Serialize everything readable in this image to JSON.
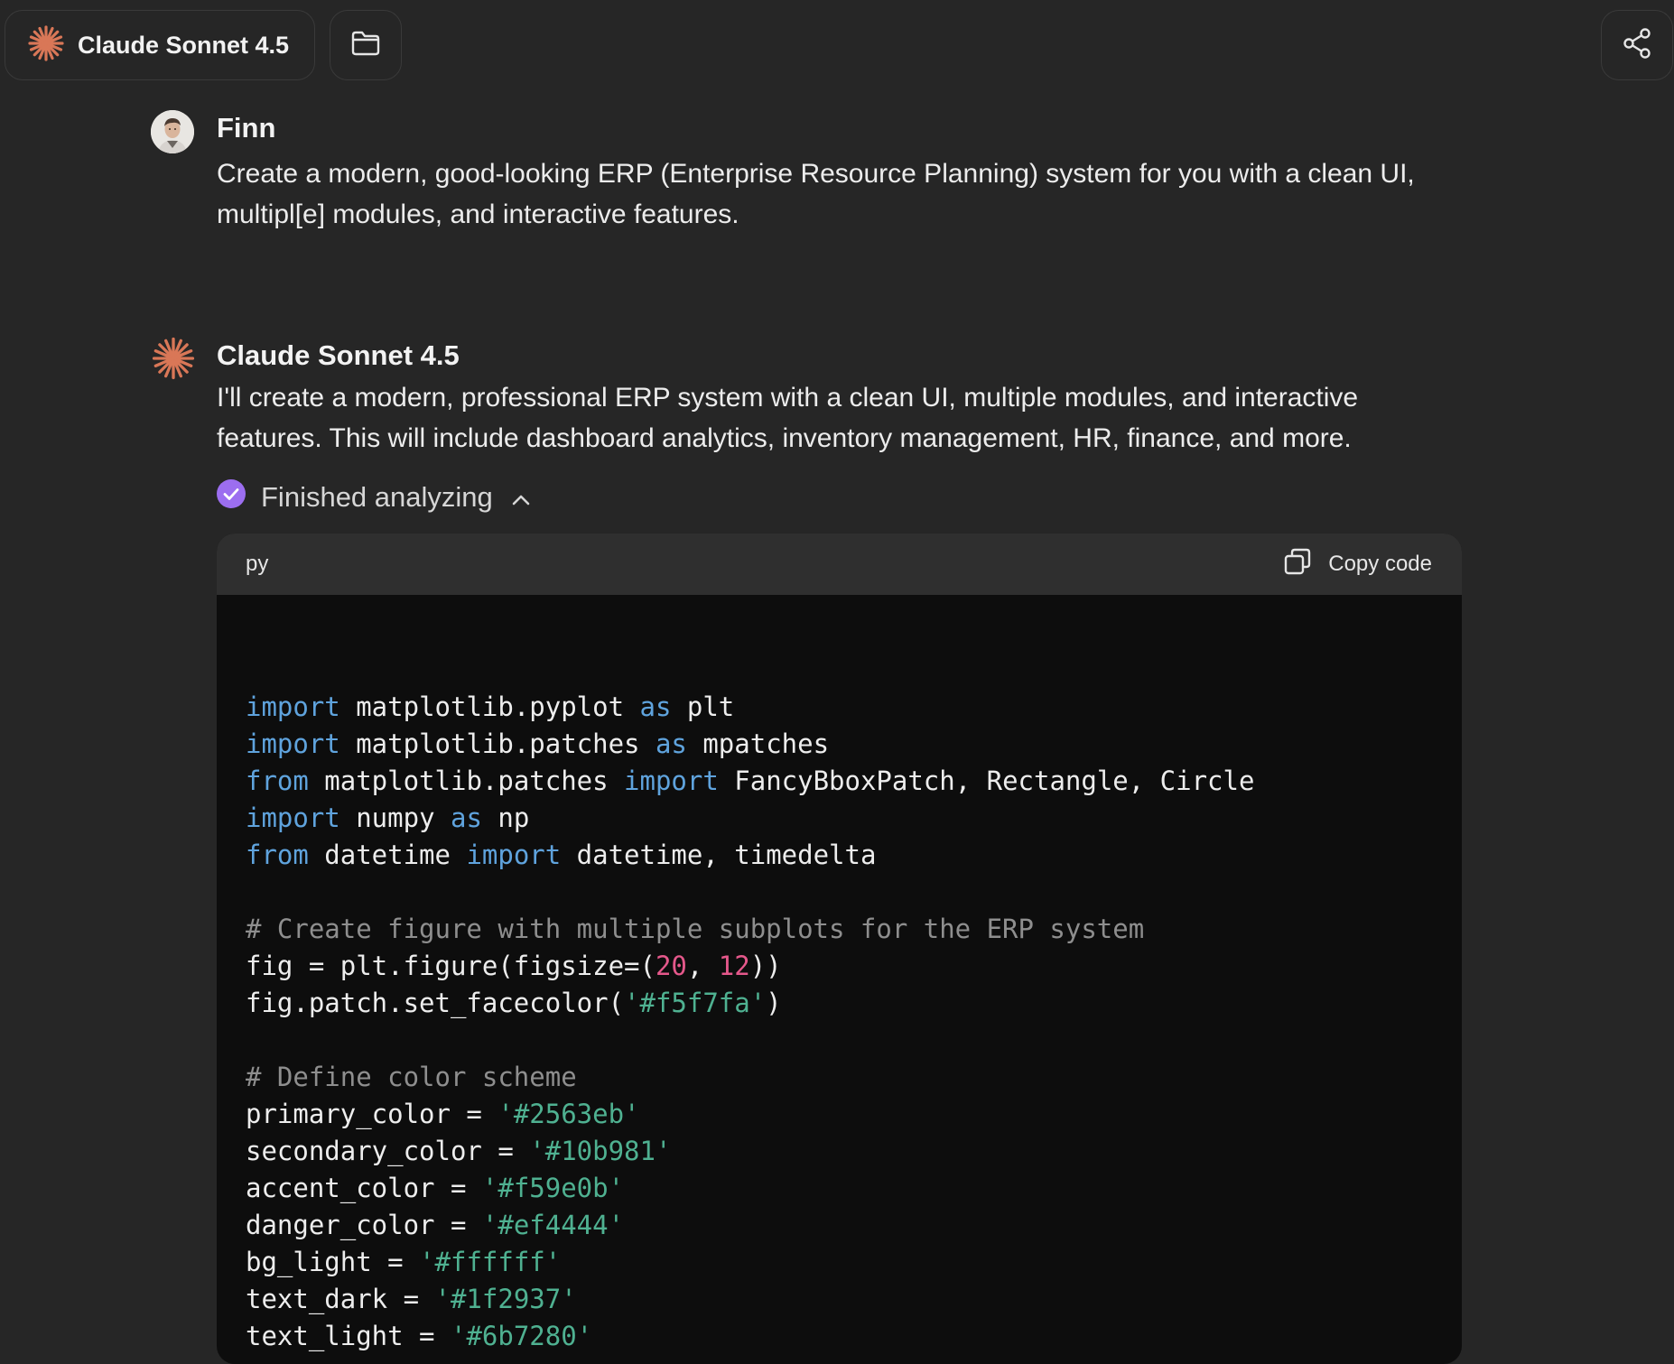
{
  "header": {
    "model_name": "Claude Sonnet 4.5"
  },
  "conversation": {
    "user_message": {
      "sender": "Finn",
      "text": "Create a modern, good-looking ERP (Enterprise Resource Planning) system for you with a clean UI, multipl[e] modules, and interactive features."
    },
    "assistant_message": {
      "sender": "Claude Sonnet 4.5",
      "text": "I'll create a modern, professional ERP system with a clean UI, multiple modules, and interactive features. This will include dashboard analytics, inventory management, HR, finance, and more.",
      "status": "Finished analyzing"
    }
  },
  "code_block": {
    "language": "py",
    "copy_label": "Copy code",
    "lines": [
      [],
      [
        {
          "t": "import",
          "c": "kw"
        },
        {
          "t": " matplotlib.pyplot "
        },
        {
          "t": "as",
          "c": "kw"
        },
        {
          "t": " plt"
        }
      ],
      [
        {
          "t": "import",
          "c": "kw"
        },
        {
          "t": " matplotlib.patches "
        },
        {
          "t": "as",
          "c": "kw"
        },
        {
          "t": " mpatches"
        }
      ],
      [
        {
          "t": "from",
          "c": "kw"
        },
        {
          "t": " matplotlib.patches "
        },
        {
          "t": "import",
          "c": "kw"
        },
        {
          "t": " FancyBboxPatch, Rectangle, Circle"
        }
      ],
      [
        {
          "t": "import",
          "c": "kw"
        },
        {
          "t": " numpy "
        },
        {
          "t": "as",
          "c": "kw"
        },
        {
          "t": " np"
        }
      ],
      [
        {
          "t": "from",
          "c": "kw"
        },
        {
          "t": " datetime "
        },
        {
          "t": "import",
          "c": "kw"
        },
        {
          "t": " datetime, timedelta"
        }
      ],
      [],
      [
        {
          "t": "# Create figure with multiple subplots for the ERP system",
          "c": "cm"
        }
      ],
      [
        {
          "t": "fig = plt.figure(figsize=("
        },
        {
          "t": "20",
          "c": "num"
        },
        {
          "t": ", "
        },
        {
          "t": "12",
          "c": "num"
        },
        {
          "t": "))"
        }
      ],
      [
        {
          "t": "fig.patch.set_facecolor("
        },
        {
          "t": "'#f5f7fa'",
          "c": "str"
        },
        {
          "t": ")"
        }
      ],
      [],
      [
        {
          "t": "# Define color scheme",
          "c": "cm"
        }
      ],
      [
        {
          "t": "primary_color = "
        },
        {
          "t": "'#2563eb'",
          "c": "str"
        }
      ],
      [
        {
          "t": "secondary_color = "
        },
        {
          "t": "'#10b981'",
          "c": "str"
        }
      ],
      [
        {
          "t": "accent_color = "
        },
        {
          "t": "'#f59e0b'",
          "c": "str"
        }
      ],
      [
        {
          "t": "danger_color = "
        },
        {
          "t": "'#ef4444'",
          "c": "str"
        }
      ],
      [
        {
          "t": "bg_light = "
        },
        {
          "t": "'#ffffff'",
          "c": "str"
        }
      ],
      [
        {
          "t": "text_dark = "
        },
        {
          "t": "'#1f2937'",
          "c": "str"
        }
      ],
      [
        {
          "t": "text_light = "
        },
        {
          "t": "'#6b7280'",
          "c": "str"
        }
      ]
    ]
  },
  "colors": {
    "background": "#262626",
    "code_background": "#0d0d0d",
    "code_header": "#2f2f2f",
    "brand_accent": "#d97757",
    "status_check": "#9c6ef0",
    "keyword": "#5fa3dd",
    "comment": "#8e8e8e",
    "string": "#4fb191",
    "number": "#e5588b"
  },
  "icons": {
    "model_logo": "claude-spark-icon",
    "folder": "folder-icon",
    "share": "share-icon",
    "status": "check-circle-icon",
    "collapse": "chevron-up-icon",
    "copy": "copy-icon"
  }
}
